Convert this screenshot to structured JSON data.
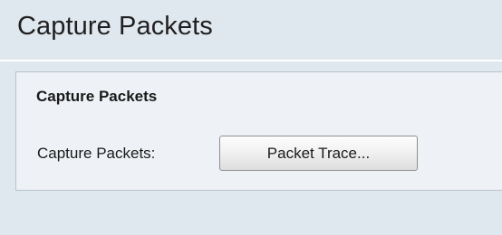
{
  "page": {
    "title": "Capture Packets"
  },
  "capture_section": {
    "heading": "Capture Packets",
    "field_label": "Capture Packets:",
    "button_label": "Packet Trace..."
  }
}
